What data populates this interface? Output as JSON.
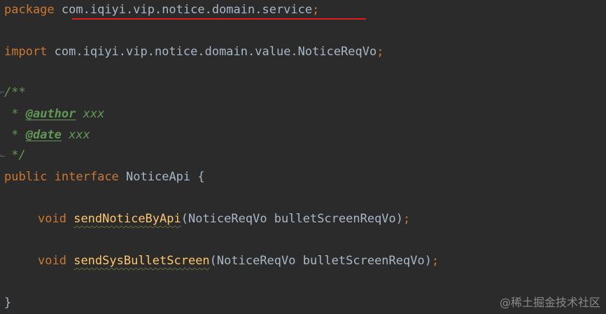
{
  "code": {
    "package_kw": "package",
    "package_name": "com.iqiyi.vip.notice.domain.service",
    "import_kw": "import",
    "import_name": "com.iqiyi.vip.notice.domain.value.NoticeReqVo",
    "semicolon": ";",
    "doc_open": "/**",
    "doc_star": " * ",
    "author_tag": "@author",
    "author_val": " xxx",
    "date_tag": "@date",
    "date_val": " xxx",
    "doc_close": " */",
    "public_kw": "public",
    "interface_kw": "interface",
    "interface_name": " NoticeApi ",
    "open_brace": "{",
    "close_brace": "}",
    "void_kw": "void",
    "method1_name": "sendNoticeByApi",
    "method1_params": "(NoticeReqVo bulletScreenReqVo)",
    "method2_name": "sendSysBulletScreen",
    "method2_params": "(NoticeReqVo bulletScreenReqVo)"
  },
  "watermark": "@稀土掘金技术社区"
}
